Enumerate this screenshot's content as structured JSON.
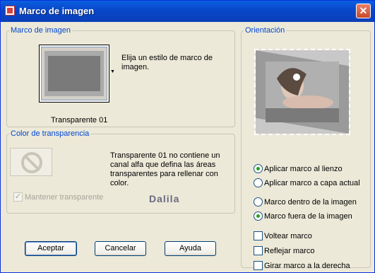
{
  "window": {
    "title": "Marco de imagen"
  },
  "frame_group": {
    "legend": "Marco de imagen",
    "hint": "Elija un estilo de marco de imagen.",
    "selected_frame": "Transparente 01"
  },
  "transparency_group": {
    "legend": "Color de transparencia",
    "message": "Transparente 01 no contiene un canal alfa que defina las áreas transparentes para rellenar con color.",
    "keep_transparent_label": "Mantener transparente",
    "keep_transparent_checked": true,
    "keep_transparent_enabled": false
  },
  "orientation_group": {
    "legend": "Orientación",
    "apply_canvas_label": "Aplicar marco al lienzo",
    "apply_layer_label": "Aplicar marco a capa actual",
    "inside_label": "Marco dentro de la imagen",
    "outside_label": "Marco fuera de la imagen",
    "flip_label": "Voltear marco",
    "mirror_label": "Reflejar marco",
    "rotate_label": "Girar marco a la derecha",
    "apply_target": "canvas",
    "frame_position": "outside",
    "flip": false,
    "mirror": false,
    "rotate": false
  },
  "buttons": {
    "ok": "Aceptar",
    "cancel": "Cancelar",
    "help": "Ayuda"
  },
  "watermark": "Dalila",
  "colors": {
    "title_bar": "#0a52d8",
    "legend_text": "#0046d5",
    "dialog_bg": "#ece9d8",
    "radio_dot": "#21a121"
  }
}
